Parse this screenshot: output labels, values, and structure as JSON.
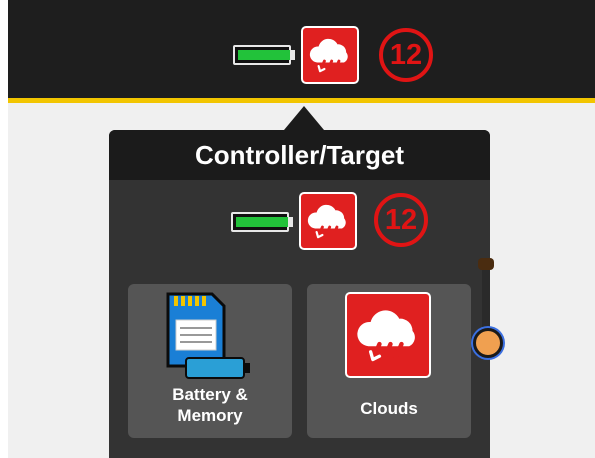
{
  "header": {
    "battery_icon": "battery-full-icon",
    "cloud_icon": "cloud-sync-icon",
    "cloud_count": "12"
  },
  "popover": {
    "title": "Controller/Target",
    "battery_icon": "battery-full-icon",
    "cloud_icon": "cloud-sync-icon",
    "cloud_count": "12",
    "tiles": [
      {
        "label": "Battery &\nMemory",
        "icon": "sd-card-battery-icon"
      },
      {
        "label": "Clouds",
        "icon": "cloud-sync-icon"
      }
    ]
  },
  "battery_level": 1.0,
  "colors": {
    "topbar": "#1e1e1e",
    "accent": "#f2c500",
    "alert_red": "#e01414",
    "battery_green": "#22c23a",
    "popover_bg": "#333333",
    "tile_bg": "#555555"
  }
}
